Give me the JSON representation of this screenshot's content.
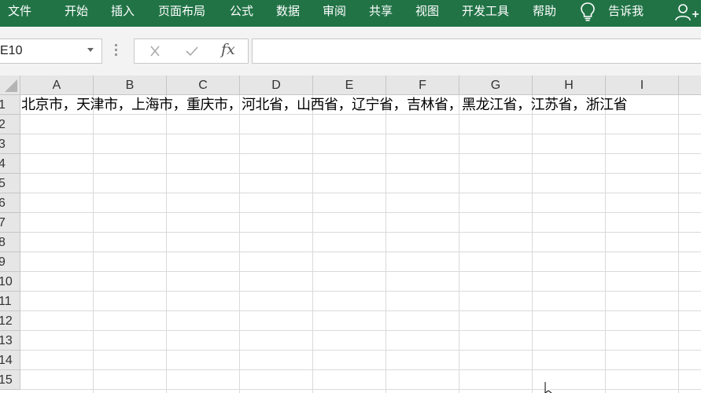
{
  "ribbon": {
    "tabs": [
      "文件",
      "开始",
      "插入",
      "页面布局",
      "公式",
      "数据",
      "审阅",
      "共享",
      "视图",
      "开发工具",
      "帮助"
    ],
    "tell_me": "告诉我"
  },
  "formula_bar": {
    "name_box": "E10",
    "cancel_icon": "✕",
    "enter_icon": "✓",
    "fx_label": "fx",
    "formula": ""
  },
  "sheet": {
    "columns": [
      "A",
      "B",
      "C",
      "D",
      "E",
      "F",
      "G",
      "H",
      "I"
    ],
    "rows": [
      "1",
      "2",
      "3",
      "4",
      "5",
      "6",
      "7",
      "8",
      "9",
      "10",
      "11",
      "12",
      "13",
      "14",
      "15"
    ],
    "a1_text": "北京市，天津市，上海市，重庆市，河北省，山西省，辽宁省，吉林省，黑龙江省，江苏省，浙江省"
  },
  "colors": {
    "ribbon": "#217346",
    "header": "#e6e6e6",
    "gridline": "#dadada"
  },
  "icons": {
    "lightbulb": "lightbulb-icon",
    "share": "person-plus-icon",
    "cursor": "mouse-pointer-icon"
  }
}
